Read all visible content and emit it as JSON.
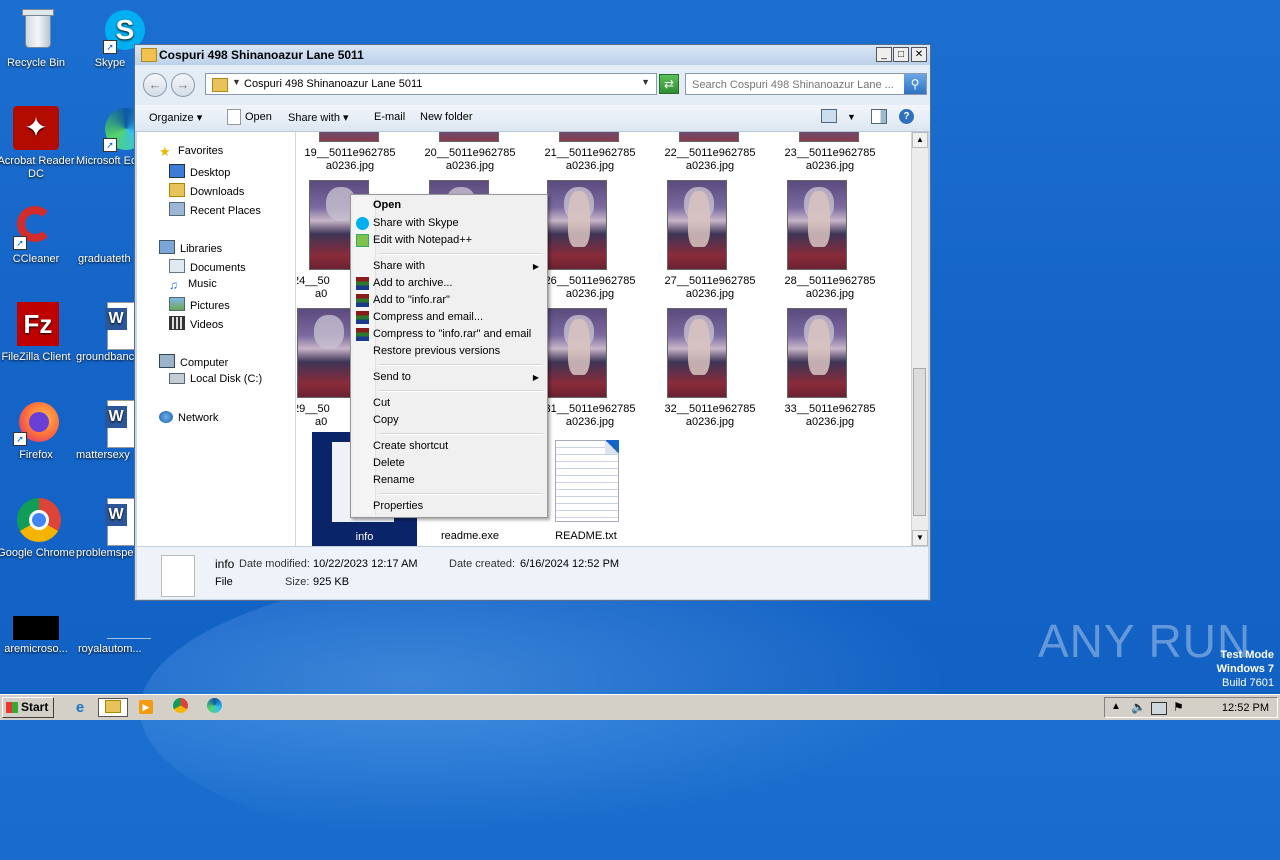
{
  "desktop": {
    "icons": [
      {
        "label": "Recycle Bin"
      },
      {
        "label": "Skype"
      },
      {
        "label": "Acrobat Reader DC"
      },
      {
        "label": "Microsoft Ed"
      },
      {
        "label": "CCleaner"
      },
      {
        "label": "graduateth"
      },
      {
        "label": "FileZilla Client"
      },
      {
        "label": "groundbanc"
      },
      {
        "label": "Firefox"
      },
      {
        "label": "mattersexy"
      },
      {
        "label": "Google Chrome"
      },
      {
        "label": "problemspe"
      },
      {
        "label": "aremicroso..."
      },
      {
        "label": "royalautom..."
      }
    ]
  },
  "window": {
    "title": "Cospuri 498 Shinanoazur Lane 5011",
    "address": "Cospuri 498 Shinanoazur Lane 5011",
    "search_placeholder": "Search Cospuri 498 Shinanoazur Lane ...",
    "toolbar": {
      "organize": "Organize",
      "open": "Open",
      "share_with": "Share with",
      "email": "E-mail",
      "new_folder": "New folder"
    },
    "nav": {
      "favorites": "Favorites",
      "desktop": "Desktop",
      "downloads": "Downloads",
      "recent_places": "Recent Places",
      "libraries": "Libraries",
      "documents": "Documents",
      "music": "Music",
      "pictures": "Pictures",
      "videos": "Videos",
      "computer": "Computer",
      "local_disk": "Local Disk (C:)",
      "network": "Network"
    },
    "files": [
      {
        "line1": "19__5011e962785",
        "line2": "a0236.jpg"
      },
      {
        "line1": "20__5011e962785",
        "line2": "a0236.jpg"
      },
      {
        "line1": "21__5011e962785",
        "line2": "a0236.jpg"
      },
      {
        "line1": "22__5011e962785",
        "line2": "a0236.jpg"
      },
      {
        "line1": "23__5011e962785",
        "line2": "a0236.jpg"
      },
      {
        "line1": "24__50",
        "line2": "a0"
      },
      {
        "line1": "26__5011e962785",
        "line2": "a0236.jpg"
      },
      {
        "line1": "27__5011e962785",
        "line2": "a0236.jpg"
      },
      {
        "line1": "28__5011e962785",
        "line2": "a0236.jpg"
      },
      {
        "line1": "29__50",
        "line2": "a0"
      },
      {
        "line1": "31__5011e962785",
        "line2": "a0236.jpg"
      },
      {
        "line1": "32__5011e962785",
        "line2": "a0236.jpg"
      },
      {
        "line1": "33__5011e962785",
        "line2": "a0236.jpg"
      },
      {
        "line1": "info",
        "line2": ""
      },
      {
        "line1": "readme.exe",
        "line2": ""
      },
      {
        "line1": "README.txt",
        "line2": ""
      }
    ],
    "details": {
      "name": "info",
      "type": "File",
      "modified_label": "Date modified:",
      "modified": "10/22/2023 12:17 AM",
      "created_label": "Date created:",
      "created": "6/16/2024 12:52 PM",
      "size_label": "Size:",
      "size": "925 KB"
    }
  },
  "context_menu": {
    "open": "Open",
    "share_skype": "Share with Skype",
    "edit_notepad": "Edit with Notepad++",
    "share_with": "Share with",
    "add_archive": "Add to archive...",
    "add_info_rar": "Add to \"info.rar\"",
    "compress_email": "Compress and email...",
    "compress_info_email": "Compress to \"info.rar\" and email",
    "restore": "Restore previous versions",
    "send_to": "Send to",
    "cut": "Cut",
    "copy": "Copy",
    "create_shortcut": "Create shortcut",
    "delete": "Delete",
    "rename": "Rename",
    "properties": "Properties"
  },
  "taskbar": {
    "start": "Start",
    "clock": "12:52 PM"
  },
  "watermark": {
    "line1": "Test Mode",
    "line2": "Windows 7",
    "line3": "Build 7601",
    "brand": "ANY RUN"
  },
  "colors": {
    "desktop_bg": "#1565c8",
    "selection": "#0a246a"
  }
}
